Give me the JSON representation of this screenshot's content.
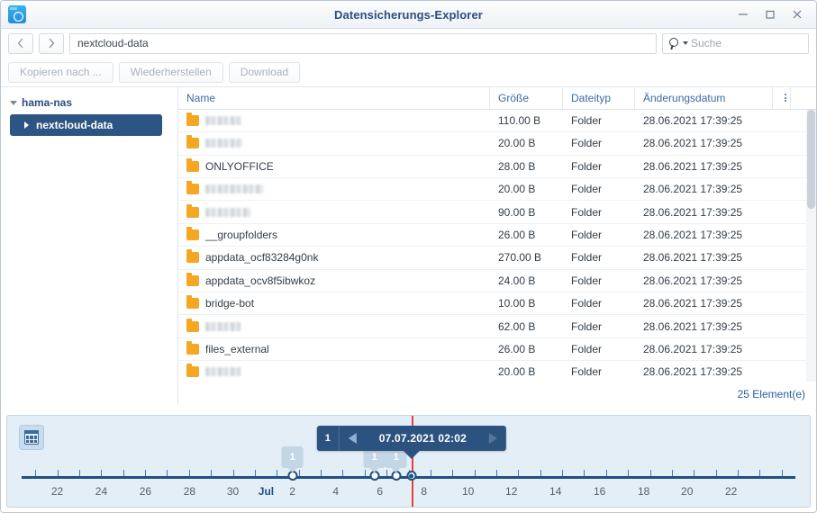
{
  "window": {
    "title": "Datensicherungs-Explorer",
    "icon": "backup-folder-clock-icon",
    "minimize_label": "—",
    "maximize_label": "❐",
    "close_label": "✕"
  },
  "address_bar": {
    "back_label": "‹",
    "forward_label": "›",
    "path_value": "nextcloud-data"
  },
  "search": {
    "placeholder": "Suche",
    "value": ""
  },
  "toolbar": {
    "buttons": [
      {
        "label": "Kopieren nach ..."
      },
      {
        "label": "Wiederherstellen"
      },
      {
        "label": "Download"
      }
    ]
  },
  "sidebar": {
    "root": {
      "label": "hama-nas"
    },
    "items": [
      {
        "label": "nextcloud-data",
        "selected": true
      }
    ]
  },
  "table": {
    "columns": [
      {
        "key": "name",
        "label": "Name"
      },
      {
        "key": "size",
        "label": "Größe"
      },
      {
        "key": "type",
        "label": "Dateityp"
      },
      {
        "key": "date",
        "label": "Änderungsdatum"
      }
    ],
    "rows": [
      {
        "name": "",
        "redacted": true,
        "redacted_width": 40,
        "size": "110.00 B",
        "type": "Folder",
        "date": "28.06.2021 17:39:25"
      },
      {
        "name": "",
        "redacted": true,
        "redacted_width": 42,
        "size": "20.00 B",
        "type": "Folder",
        "date": "28.06.2021 17:39:25"
      },
      {
        "name": "ONLYOFFICE",
        "redacted": false,
        "redacted_width": 0,
        "size": "28.00 B",
        "type": "Folder",
        "date": "28.06.2021 17:39:25"
      },
      {
        "name": "",
        "redacted": true,
        "redacted_width": 64,
        "size": "20.00 B",
        "type": "Folder",
        "date": "28.06.2021 17:39:25"
      },
      {
        "name": "",
        "redacted": true,
        "redacted_width": 50,
        "size": "90.00 B",
        "type": "Folder",
        "date": "28.06.2021 17:39:25"
      },
      {
        "name": "__groupfolders",
        "redacted": false,
        "redacted_width": 0,
        "size": "26.00 B",
        "type": "Folder",
        "date": "28.06.2021 17:39:25"
      },
      {
        "name": "appdata_ocf83284g0nk",
        "redacted": false,
        "redacted_width": 0,
        "size": "270.00 B",
        "type": "Folder",
        "date": "28.06.2021 17:39:25"
      },
      {
        "name": "appdata_ocv8f5ibwkoz",
        "redacted": false,
        "redacted_width": 0,
        "size": "24.00 B",
        "type": "Folder",
        "date": "28.06.2021 17:39:25"
      },
      {
        "name": "bridge-bot",
        "redacted": false,
        "redacted_width": 0,
        "size": "10.00 B",
        "type": "Folder",
        "date": "28.06.2021 17:39:25"
      },
      {
        "name": "",
        "redacted": true,
        "redacted_width": 40,
        "size": "62.00 B",
        "type": "Folder",
        "date": "28.06.2021 17:39:25"
      },
      {
        "name": "files_external",
        "redacted": false,
        "redacted_width": 0,
        "size": "26.00 B",
        "type": "Folder",
        "date": "28.06.2021 17:39:25"
      },
      {
        "name": "",
        "redacted": true,
        "redacted_width": 40,
        "size": "20.00 B",
        "type": "Folder",
        "date": "28.06.2021 17:39:25"
      }
    ],
    "item_count_label": "25 Element(e)"
  },
  "timeline": {
    "calendar_button": "calendar-icon",
    "selection": {
      "count": "1",
      "date_label": "07.07.2021 02:02",
      "prev_label": "◀",
      "next_label": "▶",
      "position_pct": 50.4
    },
    "snapshots": [
      {
        "count": "1",
        "position_pct": 35.0
      },
      {
        "count": "1",
        "position_pct": 45.6
      },
      {
        "count": "1",
        "position_pct": 48.4
      }
    ],
    "ticks_pct": [
      1.8,
      4.6,
      7.5,
      10.3,
      13.2,
      16.0,
      18.8,
      21.7,
      24.5,
      27.3,
      30.2,
      33.0,
      35.8,
      38.7,
      41.5,
      44.4,
      47.2,
      50.0,
      52.8,
      55.7,
      58.5,
      61.3,
      64.2,
      67.0,
      69.8,
      72.7,
      75.5,
      78.4,
      81.2,
      84.0,
      86.9,
      89.7,
      92.5,
      95.4,
      98.2
    ],
    "labels": [
      {
        "text": "22",
        "position_pct": 4.6,
        "is_month": false
      },
      {
        "text": "24",
        "position_pct": 10.3,
        "is_month": false
      },
      {
        "text": "26",
        "position_pct": 16.0,
        "is_month": false
      },
      {
        "text": "28",
        "position_pct": 21.7,
        "is_month": false
      },
      {
        "text": "30",
        "position_pct": 27.3,
        "is_month": false
      },
      {
        "text": "Jul",
        "position_pct": 31.6,
        "is_month": true
      },
      {
        "text": "2",
        "position_pct": 35.0,
        "is_month": false
      },
      {
        "text": "4",
        "position_pct": 40.6,
        "is_month": false
      },
      {
        "text": "6",
        "position_pct": 46.3,
        "is_month": false
      },
      {
        "text": "8",
        "position_pct": 52.0,
        "is_month": false
      },
      {
        "text": "10",
        "position_pct": 57.7,
        "is_month": false
      },
      {
        "text": "12",
        "position_pct": 63.3,
        "is_month": false
      },
      {
        "text": "14",
        "position_pct": 69.0,
        "is_month": false
      },
      {
        "text": "16",
        "position_pct": 74.7,
        "is_month": false
      },
      {
        "text": "18",
        "position_pct": 80.4,
        "is_month": false
      },
      {
        "text": "20",
        "position_pct": 86.0,
        "is_month": false
      },
      {
        "text": "22",
        "position_pct": 91.7,
        "is_month": false
      }
    ]
  },
  "colors": {
    "accent": "#2d5584",
    "folder": "#f5a623",
    "cursor": "#e8403a",
    "timeline_bg": "#e3eef6"
  }
}
